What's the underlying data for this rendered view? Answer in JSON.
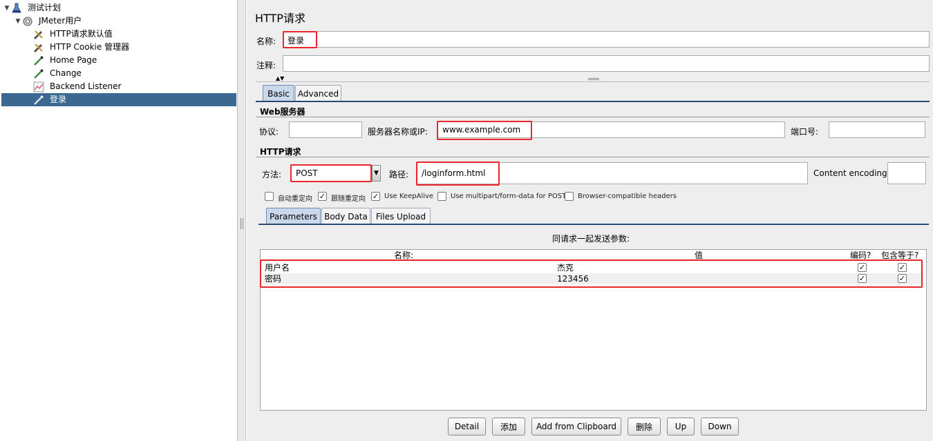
{
  "tree": {
    "items": [
      {
        "label": "测试计划",
        "icon": "flask-icon"
      },
      {
        "label": "JMeter用户",
        "icon": "gear-icon"
      },
      {
        "label": "HTTP请求默认值",
        "icon": "wrench-icon"
      },
      {
        "label": "HTTP Cookie 管理器",
        "icon": "wrench-icon"
      },
      {
        "label": "Home Page",
        "icon": "pipette-icon"
      },
      {
        "label": "Change",
        "icon": "pipette-icon"
      },
      {
        "label": "Backend Listener",
        "icon": "chart-icon"
      },
      {
        "label": "登录",
        "icon": "pipette-icon"
      }
    ]
  },
  "panel": {
    "title": "HTTP请求",
    "name_label": "名称:",
    "name_value": "登录",
    "comment_label": "注释:",
    "comment_value": "",
    "collapse_arrows": "▲▼",
    "tabs": {
      "basic": "Basic",
      "advanced": "Advanced"
    },
    "web_server": {
      "section": "Web服务器",
      "protocol_label": "协议:",
      "protocol_value": "",
      "server_label": "服务器名称或IP:",
      "server_value": "www.example.com",
      "port_label": "端口号:",
      "port_value": ""
    },
    "http_request": {
      "section": "HTTP请求",
      "method_label": "方法:",
      "method_value": "POST",
      "path_label": "路径:",
      "path_value": "/loginform.html",
      "encoding_label": "Content encoding:",
      "encoding_value": ""
    },
    "options": [
      {
        "label": "自动重定向",
        "checked": false
      },
      {
        "label": "跟随重定向",
        "checked": true
      },
      {
        "label": "Use KeepAlive",
        "checked": true
      },
      {
        "label": "Use multipart/form-data for POST",
        "checked": false
      },
      {
        "label": "Browser-compatible headers",
        "checked": false
      }
    ],
    "sub_tabs": {
      "parameters": "Parameters",
      "body": "Body Data",
      "files": "Files Upload"
    },
    "params_title": "同请求一起发送参数:",
    "columns": {
      "name": "名称:",
      "value": "值",
      "encode": "编码?",
      "include": "包含等于?"
    },
    "rows": [
      {
        "name": "用户名",
        "value": "杰克",
        "encode": true,
        "include": true
      },
      {
        "name": "密码",
        "value": "123456",
        "encode": true,
        "include": true
      }
    ],
    "buttons": {
      "detail": "Detail",
      "add": "添加",
      "clipboard": "Add from Clipboard",
      "delete": "删除",
      "up": "Up",
      "down": "Down"
    }
  },
  "colors": {
    "highlight": "#e8262c",
    "selection": "#3a6890",
    "tab_active": "#c9d8ea"
  }
}
